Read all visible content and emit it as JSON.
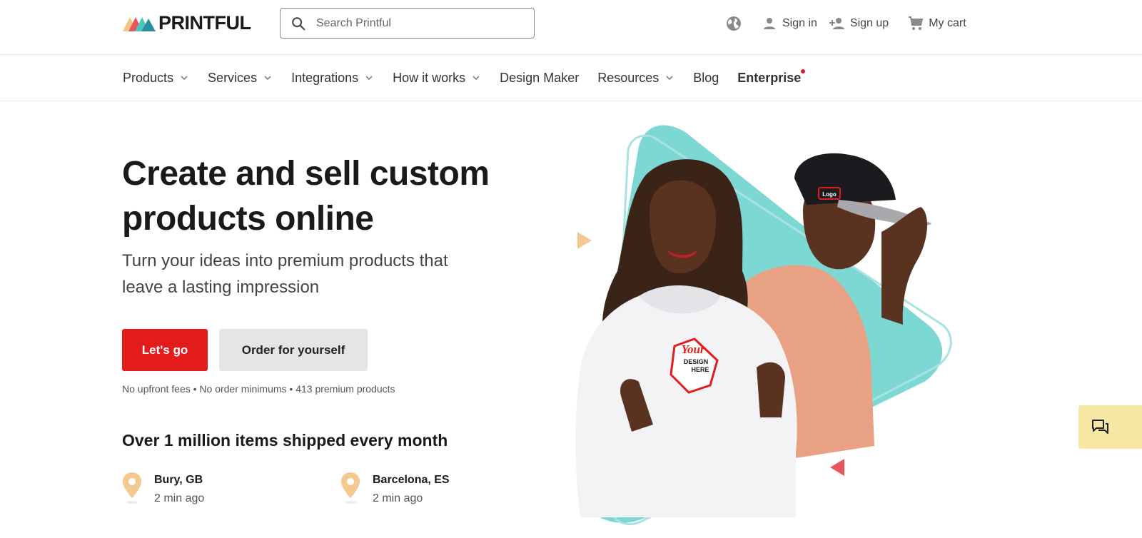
{
  "header": {
    "logo_text": "PRINTFUL",
    "search_placeholder": "Search Printful",
    "sign_in": "Sign in",
    "sign_up": "Sign up",
    "cart": "My cart"
  },
  "nav": {
    "items": [
      {
        "label": "Products",
        "dropdown": true
      },
      {
        "label": "Services",
        "dropdown": true
      },
      {
        "label": "Integrations",
        "dropdown": true
      },
      {
        "label": "How it works",
        "dropdown": true
      },
      {
        "label": "Design Maker",
        "dropdown": false
      },
      {
        "label": "Resources",
        "dropdown": true
      },
      {
        "label": "Blog",
        "dropdown": false
      },
      {
        "label": "Enterprise",
        "dropdown": false,
        "badge": true
      }
    ]
  },
  "hero": {
    "title": "Create and sell custom products online",
    "subtitle": "Turn your ideas into premium products that leave a lasting impression",
    "primary_cta": "Let's go",
    "secondary_cta": "Order for yourself",
    "features": "No upfront fees • No order minimums • 413 premium products",
    "shipped_heading": "Over 1 million items shipped every month",
    "locations": [
      {
        "name": "Bury, GB",
        "time": "2 min ago"
      },
      {
        "name": "Barcelona, ES",
        "time": "2 min ago"
      }
    ],
    "design_badge": {
      "line1": "Your",
      "line2": "DESIGN",
      "line3": "HERE"
    },
    "cap_logo": "Logo"
  },
  "colors": {
    "brand_red": "#e41b1b",
    "teal": "#7dd8d4",
    "peach": "#f3c98f",
    "chat_bg": "#f7e7a4"
  },
  "icons": {
    "search": "search-icon",
    "globe": "globe-icon",
    "user": "user-icon",
    "user_plus": "user-plus-icon",
    "cart": "cart-icon",
    "chat": "chat-icon",
    "location": "location-pin-icon"
  }
}
